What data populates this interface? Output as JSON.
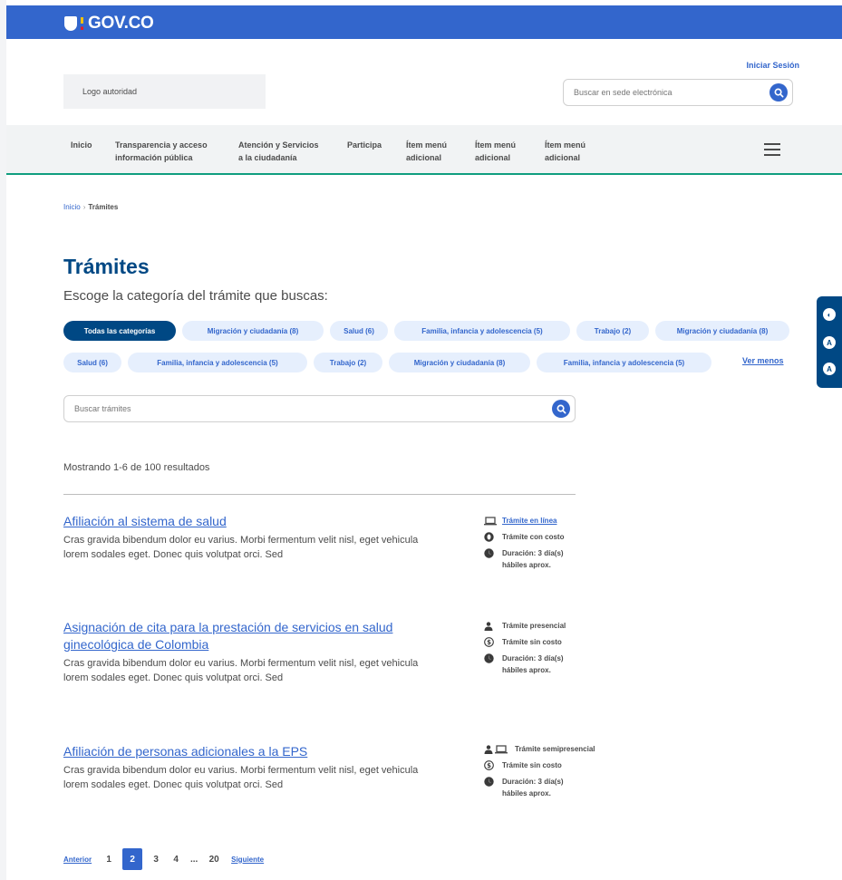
{
  "header": {
    "brand": "GOV.CO",
    "login": "Iniciar Sesión",
    "authority_logo": "Logo autoridad",
    "search_placeholder": "Buscar en sede electrónica"
  },
  "nav": {
    "items": [
      {
        "label_line1": "Inicio",
        "label_line2": ""
      },
      {
        "label_line1": "Transparencia y acceso",
        "label_line2": "información pública"
      },
      {
        "label_line1": "Atención y Servicios",
        "label_line2": "a la ciudadanía"
      },
      {
        "label_line1": "Participa",
        "label_line2": ""
      },
      {
        "label_line1": "Ítem menú",
        "label_line2": "adicional"
      },
      {
        "label_line1": "Ítem menú",
        "label_line2": "adicional"
      },
      {
        "label_line1": "Ítem menú",
        "label_line2": "adicional"
      }
    ]
  },
  "breadcrumb": {
    "home": "Inicio",
    "separator": "›",
    "current": "Trámites"
  },
  "main": {
    "title": "Trámites",
    "subtitle": "Escoge la categoría del trámite que buscas:",
    "categories_row1": [
      "Todas las categorías",
      "Migración y ciudadanía (8)",
      "Salud (6)",
      "Familia, infancia y adolescencia (5)",
      "Trabajo (2)",
      "Migración y ciudadanía (8)"
    ],
    "categories_row2": [
      "Salud (6)",
      "Familia, infancia y adolescencia (5)",
      "Trabajo (2)",
      "Migración y ciudadanía (8)",
      "Familia, infancia y adolescencia (5)"
    ],
    "ver_menos": "Ver menos",
    "filter_placeholder": "Buscar trámites",
    "results_count": "Mostrando 1-6 de 100 resultados"
  },
  "results": [
    {
      "title": "Afiliación al sistema de salud",
      "description": "Cras gravida bibendum dolor eu varius. Morbi fermentum velit nisl, eget vehicula lorem sodales eget. Donec quis volutpat orci. Sed",
      "mode": "Trámite en línea",
      "mode_icon": "laptop-icon",
      "cost": "Trámite con costo",
      "cost_icon": "coin-icon",
      "duration": "Duración: 3 día(s) hábiles aprox."
    },
    {
      "title": "Asignación de cita para la prestación de servicios en salud ginecológica de Colombia",
      "description": "Cras gravida bibendum dolor eu varius. Morbi fermentum velit nisl, eget vehicula lorem sodales eget. Donec quis volutpat orci. Sed",
      "mode": "Trámite presencial",
      "mode_icon": "person-icon",
      "cost": "Trámite sin costo",
      "cost_icon": "dollar-icon",
      "duration": "Duración: 3 día(s) hábiles aprox."
    },
    {
      "title": "Afiliación de personas adicionales a la EPS",
      "description": "Cras gravida bibendum dolor eu varius. Morbi fermentum velit nisl, eget vehicula lorem sodales eget. Donec quis volutpat orci. Sed",
      "mode": "Trámite semipresencial",
      "mode_icon": "person-laptop-icon",
      "cost": "Trámite sin costo",
      "cost_icon": "dollar-icon",
      "duration": "Duración: 3 día(s) hábiles aprox."
    }
  ],
  "pagination": {
    "prev": "Anterior",
    "pages": [
      "1",
      "2",
      "3",
      "4",
      "...",
      "20"
    ],
    "current": "2",
    "next": "Siguiente"
  },
  "accessibility": {
    "contrast": "◐",
    "font_decrease": "A",
    "font_increase": "A"
  },
  "colors": {
    "brand_blue": "#3366cc",
    "dark_blue": "#004884",
    "nav_border": "#109e7f",
    "chip_bg": "#e6effd"
  }
}
